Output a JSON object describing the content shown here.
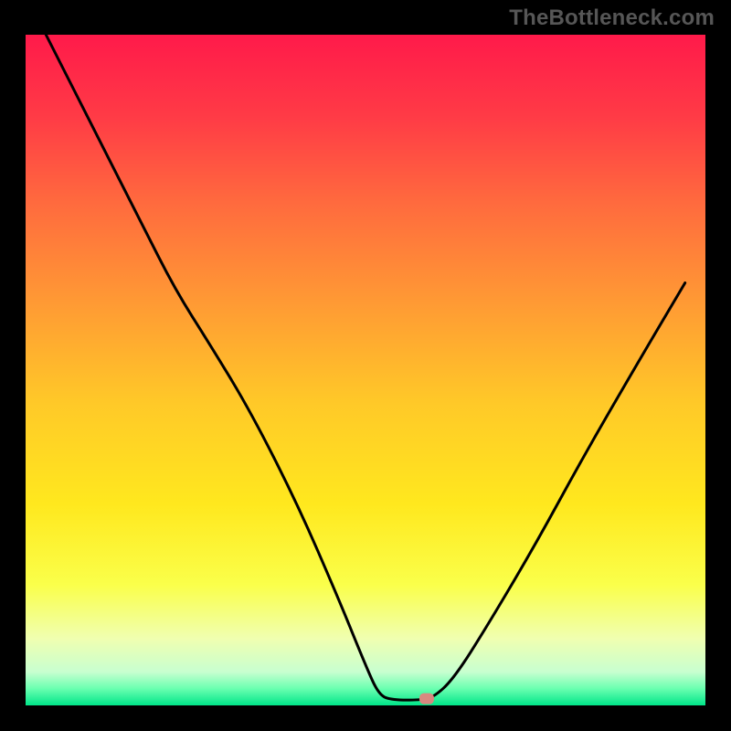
{
  "watermark": "TheBottleneck.com",
  "chart_data": {
    "type": "line",
    "title": "",
    "xlabel": "",
    "ylabel": "",
    "xlim": [
      0,
      100
    ],
    "ylim": [
      0,
      100
    ],
    "background_gradient": {
      "stops": [
        {
          "offset": 0.0,
          "color": "#ff1a4a"
        },
        {
          "offset": 0.12,
          "color": "#ff3a46"
        },
        {
          "offset": 0.25,
          "color": "#ff6a3e"
        },
        {
          "offset": 0.4,
          "color": "#ff9a34"
        },
        {
          "offset": 0.55,
          "color": "#ffc928"
        },
        {
          "offset": 0.7,
          "color": "#ffe81e"
        },
        {
          "offset": 0.82,
          "color": "#faff4a"
        },
        {
          "offset": 0.9,
          "color": "#f0ffb0"
        },
        {
          "offset": 0.95,
          "color": "#c8ffd0"
        },
        {
          "offset": 0.975,
          "color": "#6affb0"
        },
        {
          "offset": 1.0,
          "color": "#00e589"
        }
      ]
    },
    "curve": [
      {
        "x": 3.0,
        "y": 100.0
      },
      {
        "x": 10.0,
        "y": 86.0
      },
      {
        "x": 17.0,
        "y": 72.0
      },
      {
        "x": 22.0,
        "y": 62.0
      },
      {
        "x": 27.0,
        "y": 54.0
      },
      {
        "x": 33.0,
        "y": 44.0
      },
      {
        "x": 40.0,
        "y": 30.0
      },
      {
        "x": 46.0,
        "y": 16.0
      },
      {
        "x": 50.0,
        "y": 6.0
      },
      {
        "x": 52.0,
        "y": 1.5
      },
      {
        "x": 54.0,
        "y": 0.8
      },
      {
        "x": 58.0,
        "y": 0.8
      },
      {
        "x": 60.0,
        "y": 1.2
      },
      {
        "x": 63.0,
        "y": 4.0
      },
      {
        "x": 68.0,
        "y": 12.0
      },
      {
        "x": 75.0,
        "y": 24.0
      },
      {
        "x": 82.0,
        "y": 37.0
      },
      {
        "x": 90.0,
        "y": 51.0
      },
      {
        "x": 97.0,
        "y": 63.0
      }
    ],
    "marker": {
      "x": 59.0,
      "y": 1.0,
      "color": "#d98880"
    }
  }
}
